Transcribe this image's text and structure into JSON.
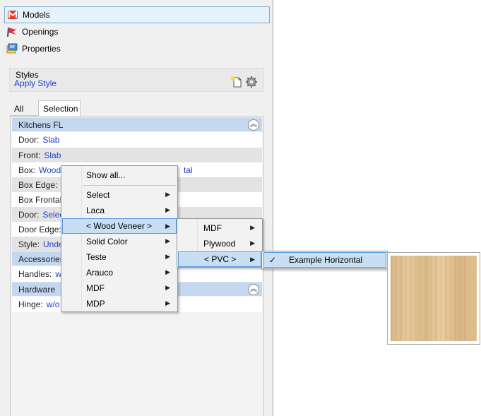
{
  "nav": {
    "models": "Models",
    "openings": "Openings",
    "properties": "Properties"
  },
  "styles": {
    "label": "Styles",
    "apply": "Apply Style"
  },
  "tabs": {
    "all": "All",
    "selection": "Selection"
  },
  "groups": {
    "kitchens": "Kitchens FL",
    "accessories": "Accessories",
    "hardware": "Hardware"
  },
  "rows": {
    "door_name": "Door:",
    "door_val": "Slab",
    "front_name": "Front:",
    "front_val": "Slab",
    "box_name": "Box:",
    "box_val": "Wood",
    "box_val_tail": "tal",
    "box_edge_name": "Box Edge:",
    "box_frontal_name": "Box Frontal",
    "door2_name": "Door:",
    "door2_val": "Selec",
    "door_edge_name": "Door Edge:",
    "style_name": "Style:",
    "style_val": "Unde",
    "handles_name": "Handles:",
    "handles_val": "w",
    "hinge_name": "Hinge:",
    "hinge_val": "w/o"
  },
  "menu1": {
    "show_all": "Show all...",
    "select": "Select",
    "laca": "Laca",
    "wood_veneer": "< Wood Veneer >",
    "solid_color": "Solid Color",
    "teste": "Teste",
    "arauco": "Arauco",
    "mdf": "MDF",
    "mdp": "MDP"
  },
  "menu2": {
    "mdf": "MDF",
    "plywood": "Plywood",
    "pvc": "< PVC >"
  },
  "menu3": {
    "example_horizontal": "Example Horizontal",
    "check": "✓"
  },
  "glyphs": {
    "submenu_arrow": "▶",
    "collapse": "︽"
  },
  "colors": {
    "link": "#1a3fd1",
    "group_header": "#c3d7ef",
    "menu_highlight": "#c8def3"
  }
}
